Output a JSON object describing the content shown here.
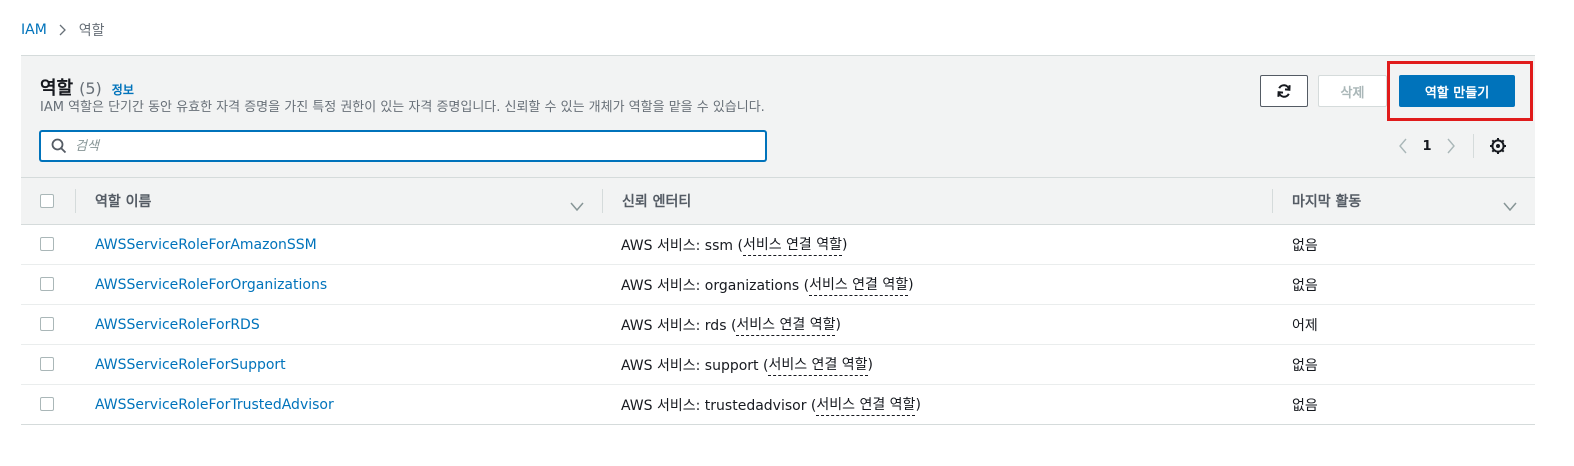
{
  "breadcrumb": {
    "root": "IAM",
    "current": "역할"
  },
  "panel": {
    "title": "역할",
    "count": "(5)",
    "info_link": "정보",
    "description": "IAM 역할은 단기간 동안 유효한 자격 증명을 가진 특정 권한이 있는 자격 증명입니다. 신뢰할 수 있는 개체가 역할을 맡을 수 있습니다."
  },
  "buttons": {
    "delete": "삭제",
    "create": "역할 만들기"
  },
  "search": {
    "placeholder": "검색",
    "value": ""
  },
  "pagination": {
    "current_page": "1"
  },
  "table": {
    "headers": {
      "role_name": "역할 이름",
      "trusted_entity": "신뢰 엔터티",
      "last_activity": "마지막 활동"
    },
    "rows": [
      {
        "role_name": "AWSServiceRoleForAmazonSSM",
        "trust_prefix": "AWS 서비스: ssm (",
        "trust_link": "서비스 연결 역할",
        "trust_suffix": ")",
        "last_activity": "없음"
      },
      {
        "role_name": "AWSServiceRoleForOrganizations",
        "trust_prefix": "AWS 서비스: organizations (",
        "trust_link": "서비스 연결 역할",
        "trust_suffix": ")",
        "last_activity": "없음"
      },
      {
        "role_name": "AWSServiceRoleForRDS",
        "trust_prefix": "AWS 서비스: rds (",
        "trust_link": "서비스 연결 역할",
        "trust_suffix": ")",
        "last_activity": "어제"
      },
      {
        "role_name": "AWSServiceRoleForSupport",
        "trust_prefix": "AWS 서비스: support (",
        "trust_link": "서비스 연결 역할",
        "trust_suffix": ")",
        "last_activity": "없음"
      },
      {
        "role_name": "AWSServiceRoleForTrustedAdvisor",
        "trust_prefix": "AWS 서비스: trustedadvisor (",
        "trust_link": "서비스 연결 역할",
        "trust_suffix": ")",
        "last_activity": "없음"
      }
    ]
  },
  "icons": {
    "breadcrumb_separator": "chevron-right-icon",
    "refresh": "refresh-icon",
    "search": "search-icon",
    "prev": "chevron-left-icon",
    "next": "chevron-right-icon",
    "settings": "gear-icon",
    "sort": "caret-down-icon"
  },
  "colors": {
    "primary": "#0073bb",
    "highlight": "#e01b1b",
    "header_bg": "#f2f3f3"
  }
}
